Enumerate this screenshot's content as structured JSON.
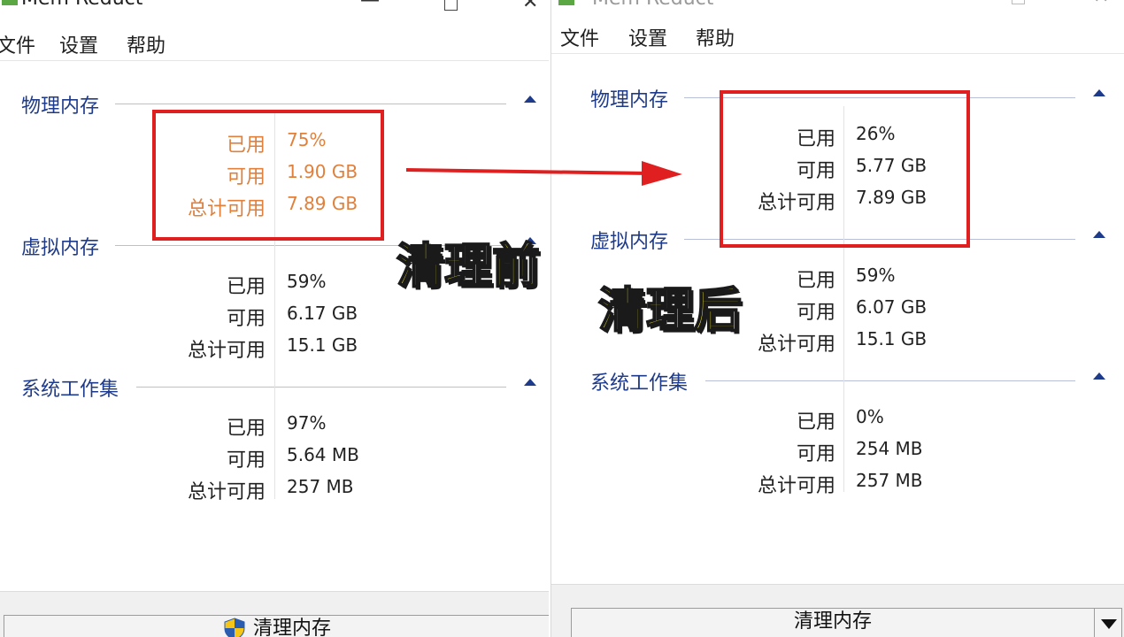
{
  "left_window": {
    "title": "Mem Reduct",
    "menu": [
      "文件",
      "设置",
      "帮助"
    ],
    "sections": [
      {
        "title": "物理内存",
        "rows": [
          {
            "label": "已用",
            "value": "75%"
          },
          {
            "label": "可用",
            "value": "1.90 GB"
          },
          {
            "label": "总计可用",
            "value": "7.89 GB"
          }
        ]
      },
      {
        "title": "虚拟内存",
        "rows": [
          {
            "label": "已用",
            "value": "59%"
          },
          {
            "label": "可用",
            "value": "6.17 GB"
          },
          {
            "label": "总计可用",
            "value": "15.1 GB"
          }
        ]
      },
      {
        "title": "系统工作集",
        "rows": [
          {
            "label": "已用",
            "value": "97%"
          },
          {
            "label": "可用",
            "value": "5.64 MB"
          },
          {
            "label": "总计可用",
            "value": "257 MB"
          }
        ]
      }
    ],
    "clean_button": "清理内存"
  },
  "right_window": {
    "title": "Mem Reduct",
    "menu": [
      "文件",
      "设置",
      "帮助"
    ],
    "sections": [
      {
        "title": "物理内存",
        "rows": [
          {
            "label": "已用",
            "value": "26%"
          },
          {
            "label": "可用",
            "value": "5.77 GB"
          },
          {
            "label": "总计可用",
            "value": "7.89 GB"
          }
        ]
      },
      {
        "title": "虚拟内存",
        "rows": [
          {
            "label": "已用",
            "value": "59%"
          },
          {
            "label": "可用",
            "value": "6.07 GB"
          },
          {
            "label": "总计可用",
            "value": "15.1 GB"
          }
        ]
      },
      {
        "title": "系统工作集",
        "rows": [
          {
            "label": "已用",
            "value": "0%"
          },
          {
            "label": "可用",
            "value": "254 MB"
          },
          {
            "label": "总计可用",
            "value": "257 MB"
          }
        ]
      }
    ],
    "clean_button": "清理内存"
  },
  "captions": {
    "before": "清理前",
    "after": "清理后"
  },
  "colors": {
    "highlight_text": "#e0803b",
    "annotation_red": "#e02020",
    "caption_yellow": "#f7ee2e",
    "section_title": "#1e3a8a"
  },
  "icons": [
    "shield-icon",
    "chevron-up-icon",
    "dropdown-arrow-icon",
    "app-icon",
    "minimize-icon",
    "maximize-icon",
    "close-icon",
    "arrow-right-icon"
  ]
}
